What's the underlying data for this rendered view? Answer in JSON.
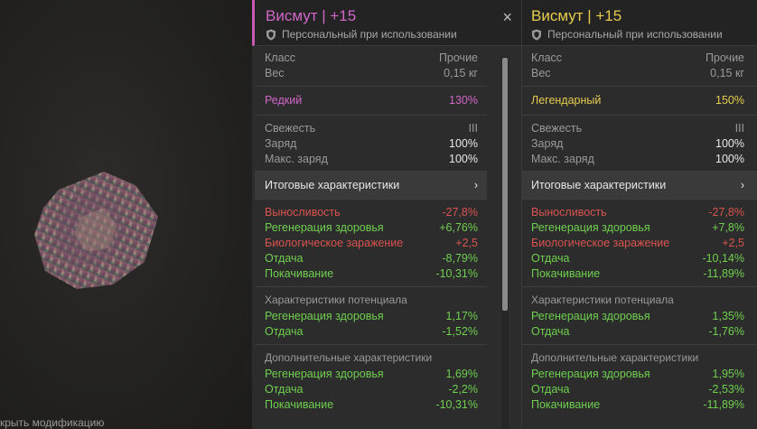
{
  "viewport": {
    "footer_hint": "крыть модификацию"
  },
  "panels": [
    {
      "title": "Висмут | +15",
      "subtitle": "Персональный при использовании",
      "close_label": "×",
      "info": [
        {
          "label": "Класс",
          "value": "Прочие"
        },
        {
          "label": "Вес",
          "value": "0,15 кг"
        }
      ],
      "rarity": {
        "label": "Редкий",
        "value": "130%"
      },
      "status": [
        {
          "label": "Свежесть",
          "value": "III"
        },
        {
          "label": "Заряд",
          "value": "100%"
        },
        {
          "label": "Макс. заряд",
          "value": "100%"
        }
      ],
      "summary_label": "Итоговые характеристики",
      "summary_arrow": "›",
      "stats": [
        {
          "label": "Выносливость",
          "value": "-27,8%",
          "tone": "neg"
        },
        {
          "label": "Регенерация здоровья",
          "value": "+6,76%",
          "tone": "pos"
        },
        {
          "label": "Биологическое заражение",
          "value": "+2,5",
          "tone": "neg"
        },
        {
          "label": "Отдача",
          "value": "-8,79%",
          "tone": "pos"
        },
        {
          "label": "Покачивание",
          "value": "-10,31%",
          "tone": "pos"
        }
      ],
      "potential_title": "Характеристики потенциала",
      "potential": [
        {
          "label": "Регенерация здоровья",
          "value": "1,17%"
        },
        {
          "label": "Отдача",
          "value": "-1,52%"
        }
      ],
      "extra_title": "Дополнительные характеристики",
      "extra": [
        {
          "label": "Регенерация здоровья",
          "value": "1,69%"
        },
        {
          "label": "Отдача",
          "value": "-2,2%"
        },
        {
          "label": "Покачивание",
          "value": "-10,31%"
        }
      ]
    },
    {
      "title": "Висмут | +15",
      "subtitle": "Персональный при использовании",
      "info": [
        {
          "label": "Класс",
          "value": "Прочие"
        },
        {
          "label": "Вес",
          "value": "0,15 кг"
        }
      ],
      "rarity": {
        "label": "Легендарный",
        "value": "150%"
      },
      "status": [
        {
          "label": "Свежесть",
          "value": "III"
        },
        {
          "label": "Заряд",
          "value": "100%"
        },
        {
          "label": "Макс. заряд",
          "value": "100%"
        }
      ],
      "summary_label": "Итоговые характеристики",
      "summary_arrow": "›",
      "stats": [
        {
          "label": "Выносливость",
          "value": "-27,8%",
          "tone": "neg"
        },
        {
          "label": "Регенерация здоровья",
          "value": "+7,8%",
          "tone": "pos"
        },
        {
          "label": "Биологическое заражение",
          "value": "+2,5",
          "tone": "neg"
        },
        {
          "label": "Отдача",
          "value": "-10,14%",
          "tone": "pos"
        },
        {
          "label": "Покачивание",
          "value": "-11,89%",
          "tone": "pos"
        }
      ],
      "potential_title": "Характеристики потенциала",
      "potential": [
        {
          "label": "Регенерация здоровья",
          "value": "1,35%"
        },
        {
          "label": "Отдача",
          "value": "-1,76%"
        }
      ],
      "extra_title": "Дополнительные характеристики",
      "extra": [
        {
          "label": "Регенерация здоровья",
          "value": "1,95%"
        },
        {
          "label": "Отдача",
          "value": "-2,53%"
        },
        {
          "label": "Покачивание",
          "value": "-11,89%"
        }
      ]
    }
  ],
  "colors": {
    "rare": "#d165c8",
    "legendary": "#e6cc4f",
    "negative": "#d9534f",
    "positive": "#6fcf4f"
  },
  "icons": {
    "personal": "shield-icon",
    "close": "close-icon",
    "expand": "chevron-right-icon",
    "artifact": "bismuth-crystal-icon"
  }
}
